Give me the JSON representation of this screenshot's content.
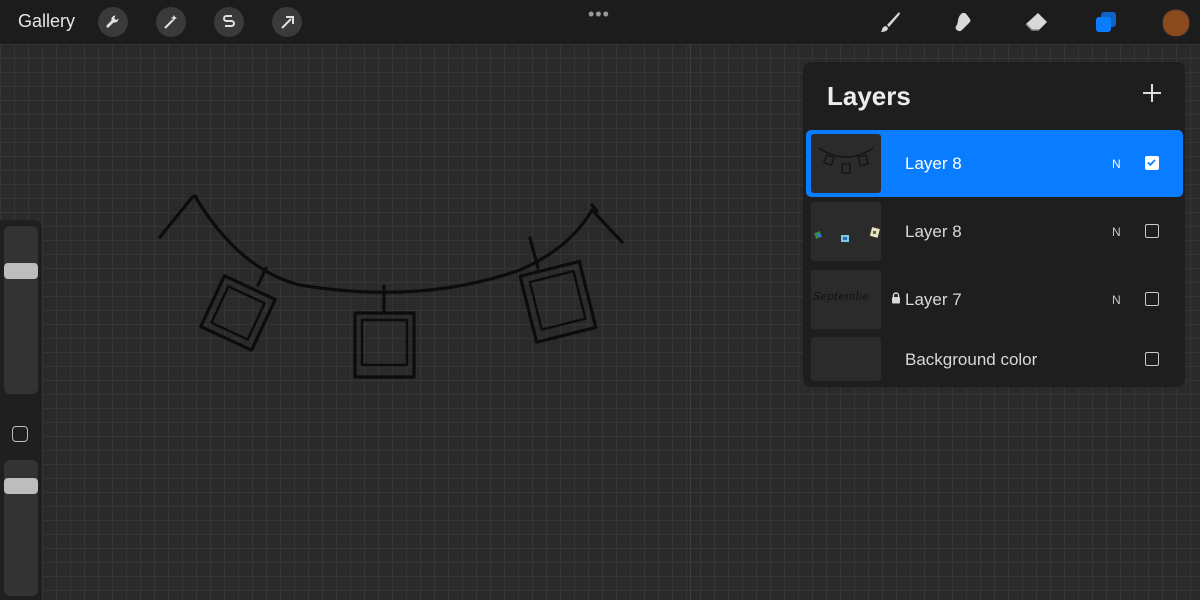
{
  "topbar": {
    "gallery_label": "Gallery",
    "left_tools": [
      "wrench-icon",
      "magic-wand-icon",
      "selection-icon",
      "transform-arrow-icon"
    ],
    "more_label": "•••",
    "right_tools": [
      "brush-icon",
      "smudge-icon",
      "eraser-icon",
      "layers-icon"
    ],
    "current_color": "#8b4a1e",
    "accent": "#0a7cff"
  },
  "sidebar": {
    "brush_size_slider": "slider",
    "modify_button": "modify-square-icon",
    "opacity_slider": "slider"
  },
  "layers_panel": {
    "title": "Layers",
    "add_label": "+",
    "layers": [
      {
        "name": "Layer 8",
        "blend": "N",
        "visible": true,
        "selected": true,
        "locked": false
      },
      {
        "name": "Layer 8",
        "blend": "N",
        "visible": false,
        "selected": false,
        "locked": false
      },
      {
        "name": "Layer 7",
        "blend": "N",
        "visible": false,
        "selected": false,
        "locked": true,
        "thumb_text": "Septembe"
      },
      {
        "name": "Background color",
        "blend": "",
        "visible": false,
        "selected": false,
        "locked": false
      }
    ]
  }
}
